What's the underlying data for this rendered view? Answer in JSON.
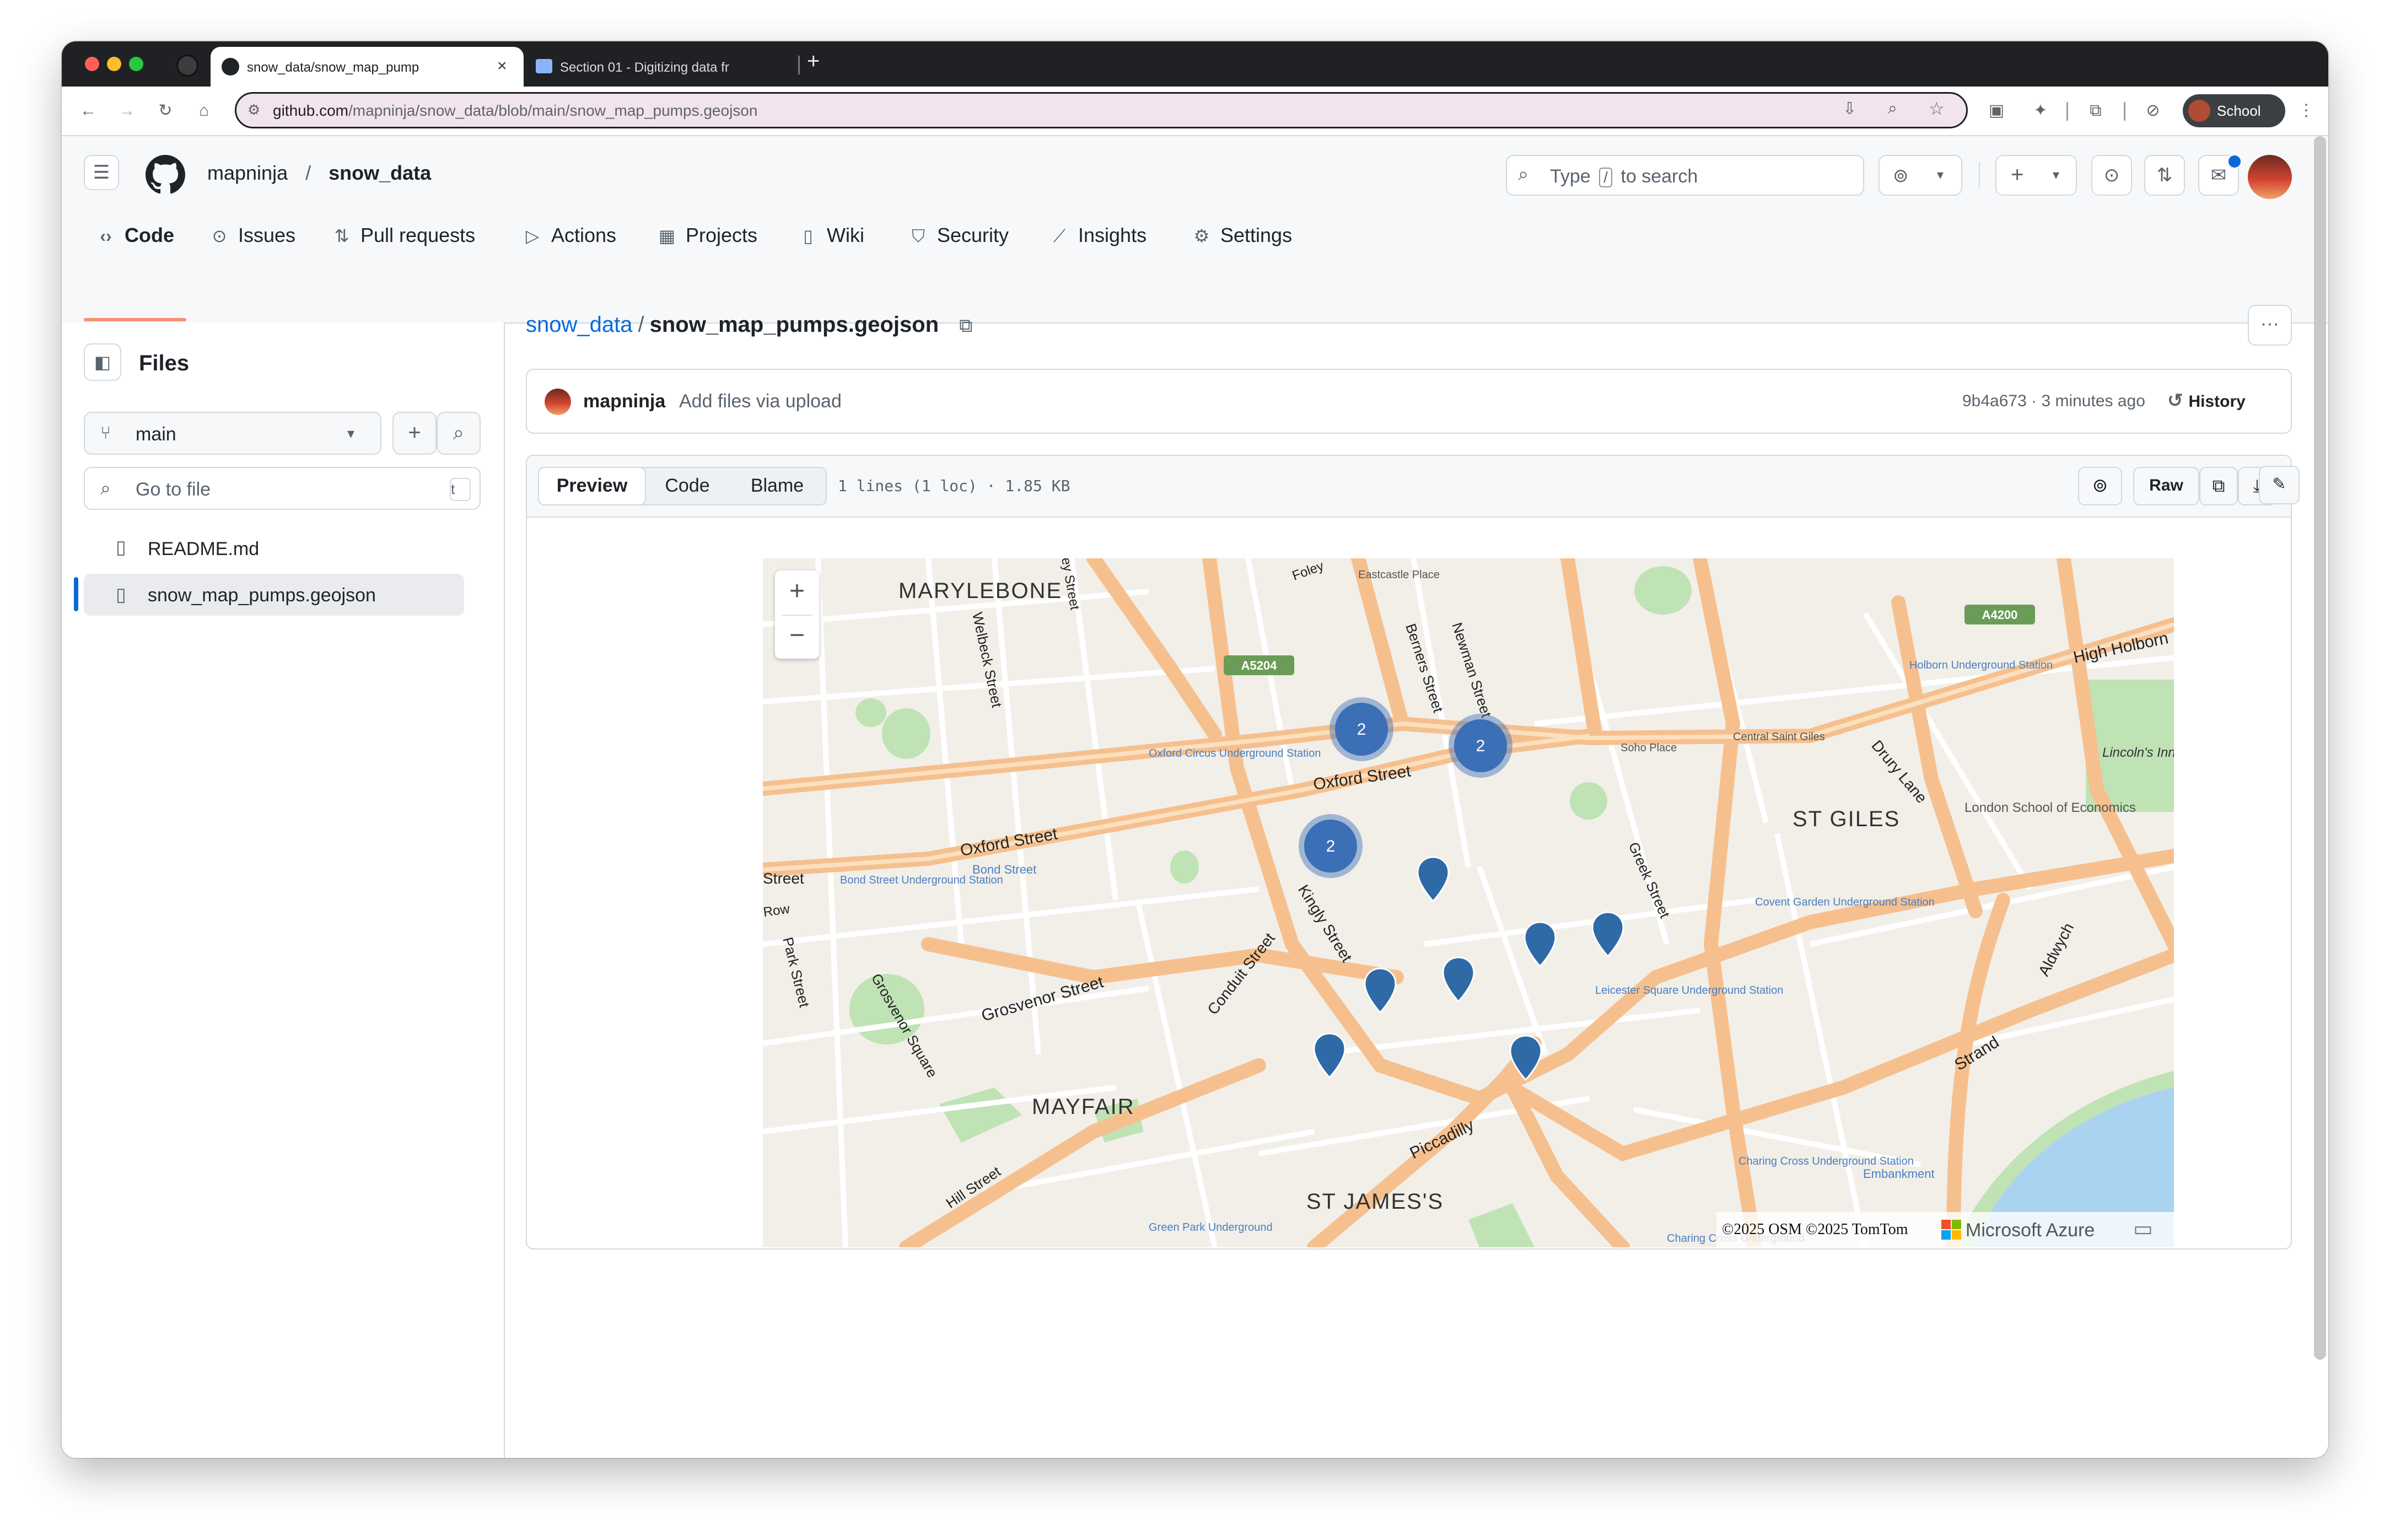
{
  "browser": {
    "tabs": [
      {
        "title": "snow_data/snow_map_pump",
        "active": true
      },
      {
        "title": "Section 01 - Digitizing data fr",
        "active": false
      }
    ],
    "new_tab_label": "+",
    "url_host": "github.com",
    "url_path": "/mapninja/snow_data/blob/main/snow_map_pumps.geojson",
    "profile_label": "School"
  },
  "header": {
    "owner": "mapninja",
    "separator": "/",
    "repo": "snow_data",
    "search_placeholder_pre": "Type",
    "search_key": "/",
    "search_placeholder_post": "to search"
  },
  "nav": {
    "tabs": [
      {
        "label": "Code",
        "icon": "code-icon",
        "active": true
      },
      {
        "label": "Issues",
        "icon": "issue-icon"
      },
      {
        "label": "Pull requests",
        "icon": "pull-request-icon"
      },
      {
        "label": "Actions",
        "icon": "play-icon"
      },
      {
        "label": "Projects",
        "icon": "table-icon"
      },
      {
        "label": "Wiki",
        "icon": "book-icon"
      },
      {
        "label": "Security",
        "icon": "shield-icon"
      },
      {
        "label": "Insights",
        "icon": "graph-icon"
      },
      {
        "label": "Settings",
        "icon": "gear-icon"
      }
    ]
  },
  "sidebar": {
    "title": "Files",
    "branch": "main",
    "goto_placeholder": "Go to file",
    "goto_shortcut": "t",
    "files": [
      {
        "name": "README.md",
        "selected": false
      },
      {
        "name": "snow_map_pumps.geojson",
        "selected": true
      }
    ]
  },
  "main": {
    "breadcrumb_repo": "snow_data",
    "breadcrumb_sep": "/",
    "file_name": "snow_map_pumps.geojson",
    "commit": {
      "author": "mapninja",
      "message": "Add files via upload",
      "sha_time": "9b4a673 · 3 minutes ago",
      "history_label": "History"
    },
    "viewer": {
      "modes": [
        "Preview",
        "Code",
        "Blame"
      ],
      "active_mode": "Preview",
      "stats": "1 lines (1 loc) · 1.85 KB",
      "raw_label": "Raw"
    }
  },
  "map": {
    "zoom_in": "+",
    "zoom_out": "−",
    "clusters": [
      {
        "count": "2"
      },
      {
        "count": "2"
      },
      {
        "count": "2"
      }
    ],
    "pin_count": 7,
    "labels": {
      "districts": [
        "MARYLEBONE",
        "ST GILES",
        "MAYFAIR",
        "ST JAMES'S"
      ],
      "streets": [
        "Oxford Street",
        "Oxford Street",
        "Kingly Street",
        "Conduit Street",
        "Grosvenor Street",
        "Piccadilly",
        "Strand",
        "Aldwych",
        "Drury Lane",
        "Greek Street",
        "Berners Street",
        "Newman Street",
        "Welbeck Street",
        "High Holborn",
        "Hill Street",
        "Park Street",
        "Grosvenor Square",
        "Street",
        "Row",
        "Foley",
        "ey Street"
      ],
      "stations": [
        "Oxford Circus Underground Station",
        "Bond Street Underground Station",
        "Bond Street",
        "Covent Garden Underground Station",
        "Leicester Square Underground Station",
        "Holborn Underground Station",
        "Charing Cross Underground Station",
        "Green Park Underground",
        "Embankment",
        "Charing Cross Underground"
      ],
      "places": [
        "Lincoln's Inn Fields",
        "London School of Economics",
        "Central Saint Giles",
        "Soho Place",
        "Eastcastle Place"
      ],
      "road_badges": [
        "A5204",
        "A4200"
      ]
    },
    "attribution": "©2025 OSM ©2025 TomTom",
    "brand": "Microsoft Azure"
  },
  "colors": {
    "accent": "#0969da",
    "active_underline": "#fd8c73",
    "cluster": "#3b6fb6",
    "pin": "#2e6aa6",
    "road_major": "#f6c08e"
  }
}
